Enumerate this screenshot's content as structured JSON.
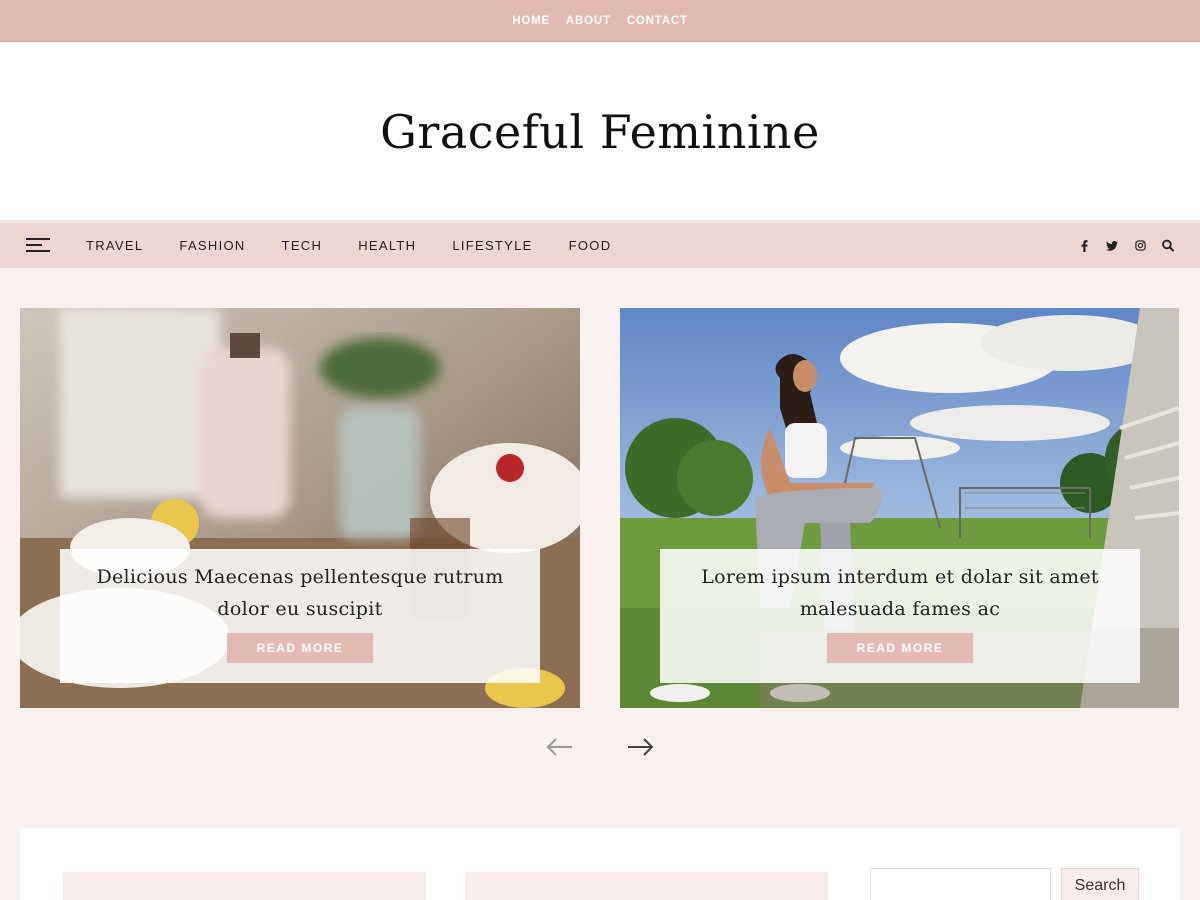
{
  "top_menu": [
    "HOME",
    "ABOUT",
    "CONTACT"
  ],
  "site_title": "Graceful Feminine",
  "main_menu": [
    "TRAVEL",
    "FASHION",
    "TECH",
    "HEALTH",
    "LIFESTYLE",
    "FOOD"
  ],
  "social_icons": [
    "facebook-icon",
    "twitter-icon",
    "instagram-icon",
    "search-icon"
  ],
  "slides": [
    {
      "title": "Delicious Maecenas pellentesque rutrum dolor eu suscipit",
      "button": "READ MORE"
    },
    {
      "title": "Lorem ipsum interdum et dolar sit amet malesuada fames ac",
      "button": "READ MORE"
    }
  ],
  "slider_nav": {
    "prev": "prev-arrow-icon",
    "next": "next-arrow-icon"
  },
  "sidebar_search": {
    "placeholder": "",
    "button": "Search"
  },
  "colors": {
    "accent": "#e2b9b3",
    "nav_bg": "#ecd6d2",
    "page_bg": "#f8f1f0"
  }
}
